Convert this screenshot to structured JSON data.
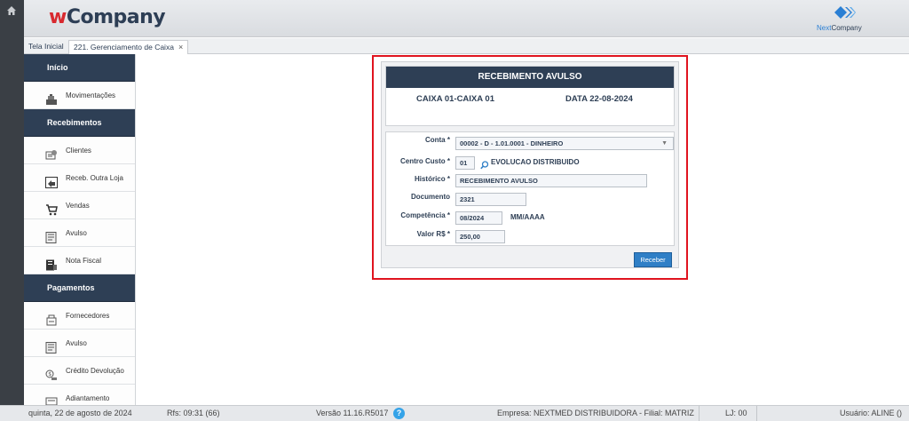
{
  "header": {
    "logo_w": "w",
    "logo_company": "Company",
    "brand_next": "Next",
    "brand_company": "Company"
  },
  "tabs": {
    "home": "Tela Inicial",
    "active": "221. Gerenciamento de Caixa",
    "close": "×"
  },
  "sidebar": {
    "sections": [
      {
        "label": "Início",
        "items": [
          {
            "label": "Movimentações",
            "icon": "cash-register-icon"
          }
        ]
      },
      {
        "label": "Recebimentos",
        "items": [
          {
            "label": "Clientes",
            "icon": "clients-icon"
          },
          {
            "label": "Receb. Outra Loja",
            "icon": "store-transfer-icon"
          },
          {
            "label": "Vendas",
            "icon": "cart-icon"
          },
          {
            "label": "Avulso",
            "icon": "form-icon"
          },
          {
            "label": "Nota Fiscal",
            "icon": "invoice-icon"
          }
        ]
      },
      {
        "label": "Pagamentos",
        "items": [
          {
            "label": "Fornecedores",
            "icon": "supplier-icon"
          },
          {
            "label": "Avulso",
            "icon": "form-icon"
          },
          {
            "label": "Crédito Devolução",
            "icon": "refund-icon"
          },
          {
            "label": "Adiantamento",
            "icon": "advance-icon"
          }
        ]
      }
    ]
  },
  "form": {
    "title": "RECEBIMENTO AVULSO",
    "caixa": "CAIXA  01-CAIXA 01",
    "data": "DATA  22-08-2024",
    "fields": {
      "conta": {
        "label": "Conta",
        "value": "00002 - D - 1.01.0001 - DINHEIRO"
      },
      "centro_custo": {
        "label": "Centro Custo",
        "code": "01",
        "description": "EVOLUCAO DISTRIBUIDO"
      },
      "historico": {
        "label": "Histórico",
        "value": "RECEBIMENTO AVULSO"
      },
      "documento": {
        "label": "Documento",
        "value": "2321"
      },
      "competencia": {
        "label": "Competência",
        "value": "08/2024",
        "hint": "MM/AAAA"
      },
      "valor": {
        "label": "Valor R$",
        "value": "250,00"
      }
    },
    "required_mark": "*",
    "submit_label": "Receber"
  },
  "statusbar": {
    "date": "quinta, 22 de agosto de 2024",
    "rfs": "Rfs: 09:31 (66)",
    "version": "Versão 11.16.R5017",
    "help": "?",
    "empresa": "Empresa: NEXTMED DISTRIBUIDORA - Filial: MATRIZ",
    "lj": "LJ: 00",
    "usuario": "Usuário: ALINE ()"
  },
  "colors": {
    "navy": "#2e3f55",
    "accent_red": "#e0141f",
    "button_blue": "#2f7fc6"
  }
}
